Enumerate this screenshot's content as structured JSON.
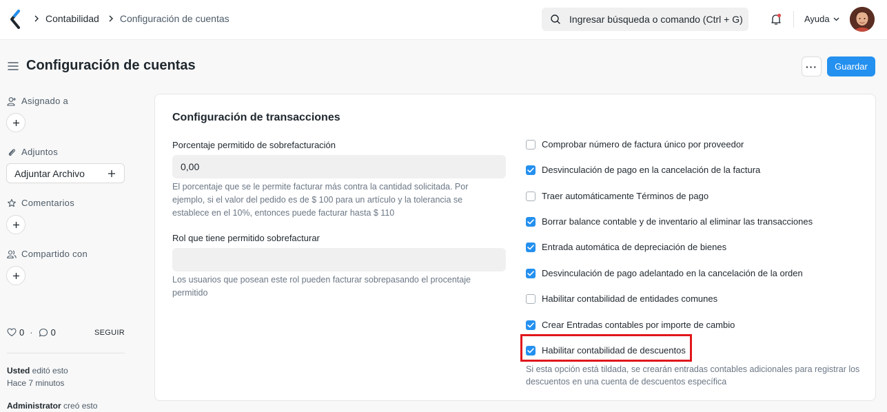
{
  "navbar": {
    "breadcrumb_1": "Contabilidad",
    "breadcrumb_2": "Configuración de cuentas",
    "search_placeholder": "Ingresar búsqueda o comando (Ctrl + G)",
    "help_label": "Ayuda"
  },
  "page": {
    "title": "Configuración de cuentas",
    "more_label": "···",
    "save_label": "Guardar"
  },
  "sidebar": {
    "assigned_label": "Asignado a",
    "attachments_label": "Adjuntos",
    "attach_button": "Adjuntar Archivo",
    "comments_label": "Comentarios",
    "shared_label": "Compartido con",
    "likes": "0",
    "comments_count": "0",
    "dot": "·",
    "follow_label": "SEGUIR",
    "activity": [
      {
        "user": "Usted",
        "action": " editó esto",
        "time": "Hace 7 minutos"
      },
      {
        "user": "Administrator",
        "action": " creó esto"
      }
    ]
  },
  "form": {
    "section_title": "Configuración de transacciones",
    "fields": [
      {
        "label": "Porcentaje permitido de sobrefacturación",
        "value": "0,00",
        "description": "El porcentaje que se le permite facturar más contra la cantidad solicitada. Por ejemplo, si el valor del pedido es de $ 100 para un artículo y la tolerancia se establece en el 10%, entonces puede facturar hasta $ 110"
      },
      {
        "label": "Rol que tiene permitido sobrefacturar",
        "value": "",
        "description": "Los usuarios que posean este rol pueden facturar sobrepasando el procentaje permitido"
      }
    ],
    "checkboxes": [
      {
        "label": "Comprobar número de factura único por proveedor",
        "checked": false
      },
      {
        "label": "Desvinculación de pago en la cancelación de la factura",
        "checked": true
      },
      {
        "label": "Traer automáticamente Términos de pago",
        "checked": false
      },
      {
        "label": "Borrar balance contable y de inventario al eliminar las transacciones",
        "checked": true
      },
      {
        "label": "Entrada automática de depreciación de bienes",
        "checked": true
      },
      {
        "label": "Desvinculación de pago adelantado en la cancelación de la orden",
        "checked": true
      },
      {
        "label": "Habilitar contabilidad de entidades comunes",
        "checked": false
      },
      {
        "label": "Crear Entradas contables por importe de cambio",
        "checked": true
      },
      {
        "label": "Habilitar contabilidad de descuentos",
        "checked": true
      }
    ],
    "discount_description": "Si esta opción está tildada, se crearán entradas contables adicionales para registrar los descuentos en una cuenta de descuentos específica"
  },
  "colors": {
    "primary": "#2490ef",
    "highlight": "#e0161c"
  }
}
